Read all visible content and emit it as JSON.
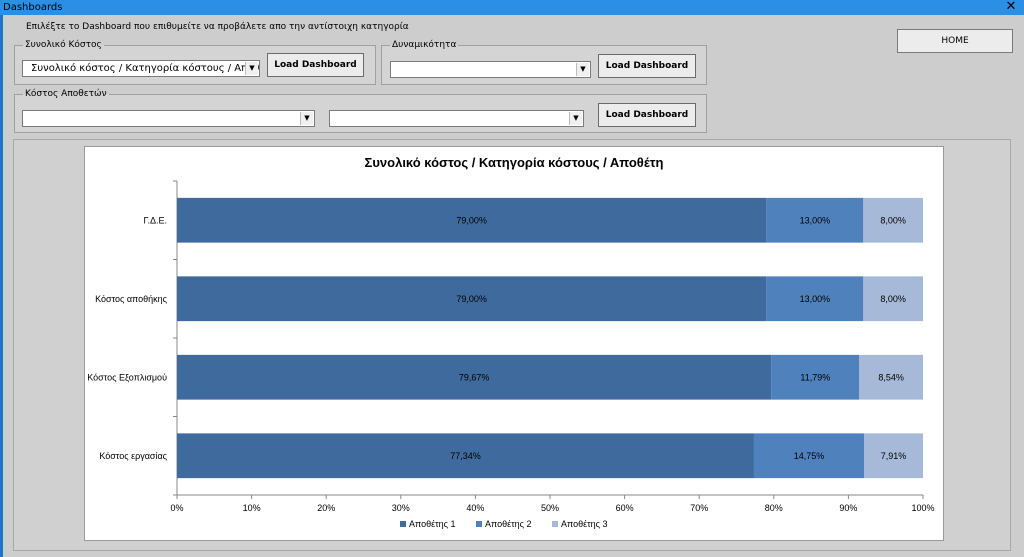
{
  "window": {
    "title": "Dashboards",
    "close_glyph": "✕",
    "instruction": "Επιλέξτε το Dashboard που επιθυμείτε να προβάλετε απο την αντίστοιχη κατηγορία",
    "home_label": "HOME"
  },
  "groups": {
    "total_cost": {
      "legend": "Συνολικό Κόστος",
      "combo_value": "Συνολικό κόστος / Κατηγορία κόστους / Αποθέτη",
      "button": "Load Dashboard"
    },
    "capacity": {
      "legend": "Δυναμικότητα",
      "combo_value": "",
      "button": "Load Dashboard"
    },
    "depositor_cost": {
      "legend": "Κόστος Αποθετών",
      "combo1_value": "",
      "combo2_value": "",
      "button": "Load Dashboard"
    }
  },
  "icons": {
    "dropdown": "▼",
    "close": "close-icon"
  },
  "chart_data": {
    "type": "bar",
    "orientation": "horizontal",
    "stacked": "100%",
    "title": "Συνολικό κόστος / Κατηγορία κόστους / Αποθέτη",
    "categories": [
      "Γ.Δ.Ε.",
      "Κόστος αποθήκης",
      "Κόστος Εξοπλισμού",
      "Κόστος εργασίας"
    ],
    "series": [
      {
        "name": "Αποθέτης 1",
        "color": "#3f6a9e",
        "values": [
          79.0,
          79.0,
          79.67,
          77.34
        ],
        "labels": [
          "79,00%",
          "79,00%",
          "79,67%",
          "77,34%"
        ]
      },
      {
        "name": "Αποθέτης 2",
        "color": "#4f81bd",
        "values": [
          13.0,
          13.0,
          11.79,
          14.75
        ],
        "labels": [
          "13,00%",
          "13,00%",
          "11,79%",
          "14,75%"
        ]
      },
      {
        "name": "Αποθέτης 3",
        "color": "#a7b9d9",
        "values": [
          8.0,
          8.0,
          8.54,
          7.91
        ],
        "labels": [
          "8,00%",
          "8,00%",
          "8,54%",
          "7,91%"
        ]
      }
    ],
    "xlim": [
      0,
      100
    ],
    "xticks": [
      "0%",
      "10%",
      "20%",
      "30%",
      "40%",
      "50%",
      "60%",
      "70%",
      "80%",
      "90%",
      "100%"
    ],
    "grid": false,
    "legend_position": "bottom"
  }
}
